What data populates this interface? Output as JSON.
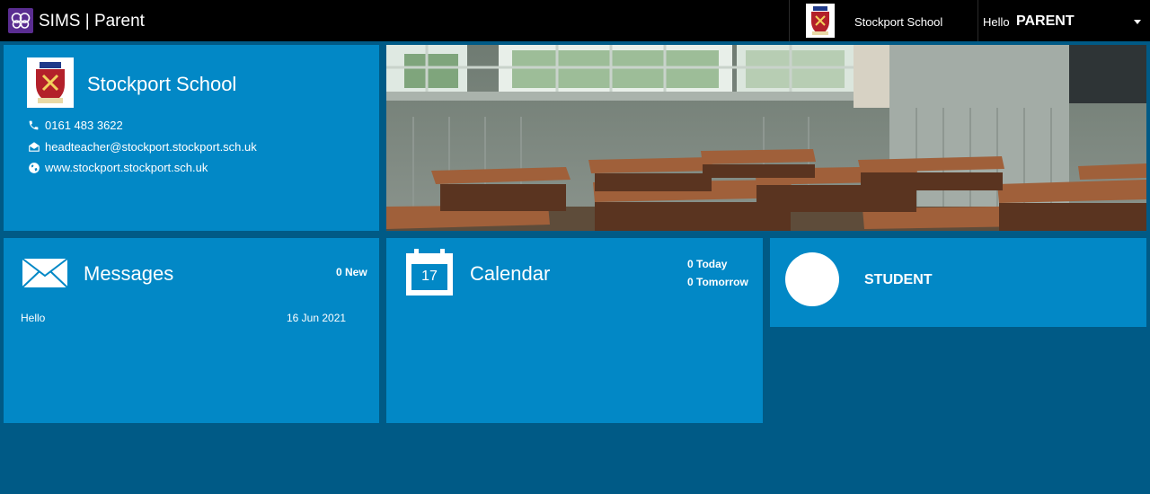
{
  "app": {
    "title": "SIMS | Parent"
  },
  "header": {
    "school_name": "Stockport School",
    "greeting": "Hello",
    "user_name": "PARENT"
  },
  "school": {
    "name": "Stockport School",
    "phone": "0161 483 3622",
    "email": "headteacher@stockport.stockport.sch.uk",
    "website": "www.stockport.stockport.sch.uk"
  },
  "messages": {
    "title": "Messages",
    "new_count": "0 New",
    "items": [
      {
        "subject": "Hello",
        "date": "16 Jun 2021"
      }
    ]
  },
  "calendar": {
    "title": "Calendar",
    "day_number": "17",
    "today": "0 Today",
    "tomorrow": "0 Tomorrow"
  },
  "student": {
    "name": "STUDENT"
  },
  "icons": {
    "logo": "sims-logo-icon",
    "phone": "phone-icon",
    "email": "envelope-open-icon",
    "website": "globe-icon",
    "messages": "envelope-icon",
    "calendar": "calendar-icon",
    "caret": "chevron-down-icon"
  },
  "colors": {
    "tile": "#0288c6",
    "background": "#005a86",
    "topbar": "#000000",
    "logo": "#5a2d91"
  }
}
